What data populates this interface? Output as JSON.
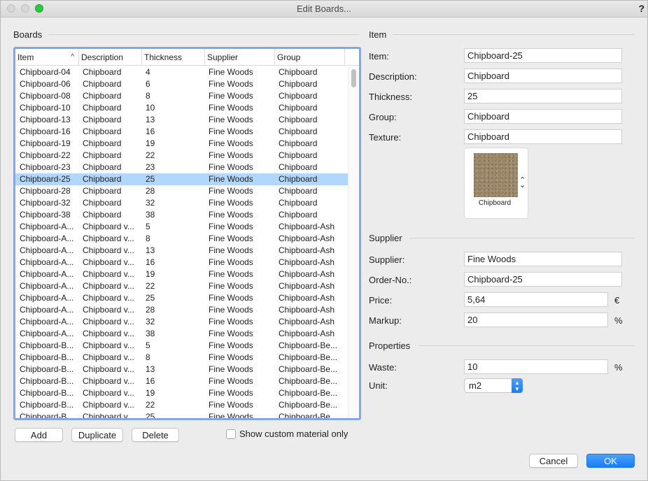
{
  "window": {
    "title": "Edit Boards...",
    "help": "?"
  },
  "boards": {
    "section_title": "Boards",
    "columns": [
      "Item",
      "Description",
      "Thickness",
      "Supplier",
      "Group"
    ],
    "sort_indicator": "^",
    "rows": [
      [
        "Chipboard-04",
        "Chipboard",
        "4",
        "Fine Woods",
        "Chipboard"
      ],
      [
        "Chipboard-06",
        "Chipboard",
        "6",
        "Fine Woods",
        "Chipboard"
      ],
      [
        "Chipboard-08",
        "Chipboard",
        "8",
        "Fine Woods",
        "Chipboard"
      ],
      [
        "Chipboard-10",
        "Chipboard",
        "10",
        "Fine Woods",
        "Chipboard"
      ],
      [
        "Chipboard-13",
        "Chipboard",
        "13",
        "Fine Woods",
        "Chipboard"
      ],
      [
        "Chipboard-16",
        "Chipboard",
        "16",
        "Fine Woods",
        "Chipboard"
      ],
      [
        "Chipboard-19",
        "Chipboard",
        "19",
        "Fine Woods",
        "Chipboard"
      ],
      [
        "Chipboard-22",
        "Chipboard",
        "22",
        "Fine Woods",
        "Chipboard"
      ],
      [
        "Chipboard-23",
        "Chipboard",
        "23",
        "Fine Woods",
        "Chipboard"
      ],
      [
        "Chipboard-25",
        "Chipboard",
        "25",
        "Fine Woods",
        "Chipboard"
      ],
      [
        "Chipboard-28",
        "Chipboard",
        "28",
        "Fine Woods",
        "Chipboard"
      ],
      [
        "Chipboard-32",
        "Chipboard",
        "32",
        "Fine Woods",
        "Chipboard"
      ],
      [
        "Chipboard-38",
        "Chipboard",
        "38",
        "Fine Woods",
        "Chipboard"
      ],
      [
        "Chipboard-A...",
        "Chipboard v...",
        "5",
        "Fine Woods",
        "Chipboard-Ash"
      ],
      [
        "Chipboard-A...",
        "Chipboard v...",
        "8",
        "Fine Woods",
        "Chipboard-Ash"
      ],
      [
        "Chipboard-A...",
        "Chipboard v...",
        "13",
        "Fine Woods",
        "Chipboard-Ash"
      ],
      [
        "Chipboard-A...",
        "Chipboard v...",
        "16",
        "Fine Woods",
        "Chipboard-Ash"
      ],
      [
        "Chipboard-A...",
        "Chipboard v...",
        "19",
        "Fine Woods",
        "Chipboard-Ash"
      ],
      [
        "Chipboard-A...",
        "Chipboard v...",
        "22",
        "Fine Woods",
        "Chipboard-Ash"
      ],
      [
        "Chipboard-A...",
        "Chipboard v...",
        "25",
        "Fine Woods",
        "Chipboard-Ash"
      ],
      [
        "Chipboard-A...",
        "Chipboard v...",
        "28",
        "Fine Woods",
        "Chipboard-Ash"
      ],
      [
        "Chipboard-A...",
        "Chipboard v...",
        "32",
        "Fine Woods",
        "Chipboard-Ash"
      ],
      [
        "Chipboard-A...",
        "Chipboard v...",
        "38",
        "Fine Woods",
        "Chipboard-Ash"
      ],
      [
        "Chipboard-B...",
        "Chipboard v...",
        "5",
        "Fine Woods",
        "Chipboard-Be..."
      ],
      [
        "Chipboard-B...",
        "Chipboard v...",
        "8",
        "Fine Woods",
        "Chipboard-Be..."
      ],
      [
        "Chipboard-B...",
        "Chipboard v...",
        "13",
        "Fine Woods",
        "Chipboard-Be..."
      ],
      [
        "Chipboard-B...",
        "Chipboard v...",
        "16",
        "Fine Woods",
        "Chipboard-Be..."
      ],
      [
        "Chipboard-B...",
        "Chipboard v...",
        "19",
        "Fine Woods",
        "Chipboard-Be..."
      ],
      [
        "Chipboard-B...",
        "Chipboard v...",
        "22",
        "Fine Woods",
        "Chipboard-Be..."
      ],
      [
        "Chipboard-B...",
        "Chipboard v...",
        "25",
        "Fine Woods",
        "Chipboard-Be..."
      ]
    ],
    "selected_row": 9,
    "buttons": {
      "add": "Add",
      "duplicate": "Duplicate",
      "delete": "Delete"
    },
    "show_custom_label": "Show custom material only",
    "show_custom_checked": false
  },
  "item": {
    "section_title": "Item",
    "item_label": "Item:",
    "item_value": "Chipboard-25",
    "description_label": "Description:",
    "description_value": "Chipboard",
    "thickness_label": "Thickness:",
    "thickness_value": "25",
    "group_label": "Group:",
    "group_value": "Chipboard",
    "texture_label": "Texture:",
    "texture_value": "Chipboard",
    "texture_caption": "Chipboard"
  },
  "supplier": {
    "section_title": "Supplier",
    "supplier_label": "Supplier:",
    "supplier_value": "Fine Woods",
    "order_label": "Order-No.:",
    "order_value": "Chipboard-25",
    "price_label": "Price:",
    "price_value": "5,64",
    "price_unit": "€",
    "markup_label": "Markup:",
    "markup_value": "20",
    "markup_unit": "%"
  },
  "properties": {
    "section_title": "Properties",
    "waste_label": "Waste:",
    "waste_value": "10",
    "waste_unit": "%",
    "unit_label": "Unit:",
    "unit_value": "m2"
  },
  "footer": {
    "cancel": "Cancel",
    "ok": "OK"
  },
  "colors": {
    "accent": "#1a7cf5",
    "selection": "#b3d7fb",
    "table_focus_border": "#80a8e6",
    "texture": "#a08c6d"
  }
}
